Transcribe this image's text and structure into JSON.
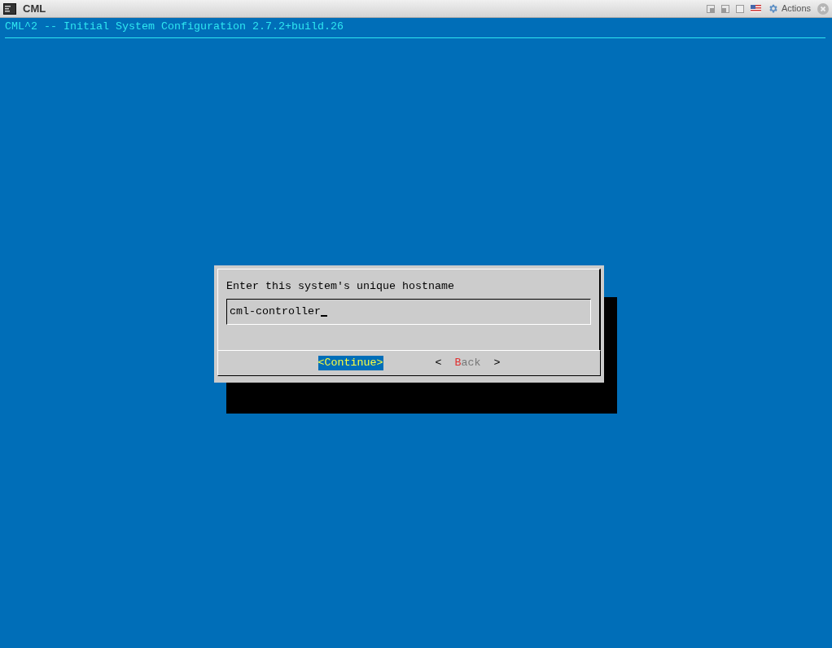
{
  "window": {
    "title": "CML",
    "actions_label": "Actions"
  },
  "terminal": {
    "header": "CML^2 -- Initial System Configuration 2.7.2+build.26"
  },
  "dialog": {
    "prompt": "Enter this system's unique hostname",
    "input": {
      "value": "cml-controller",
      "cursor": true
    },
    "buttons": [
      {
        "open": "<",
        "hotkey": "C",
        "rest": "ontinue",
        "close": ">",
        "selected": true
      },
      {
        "open": "<",
        "hotkey": "B",
        "rest": "ack",
        "close": ">",
        "selected": false
      }
    ]
  }
}
